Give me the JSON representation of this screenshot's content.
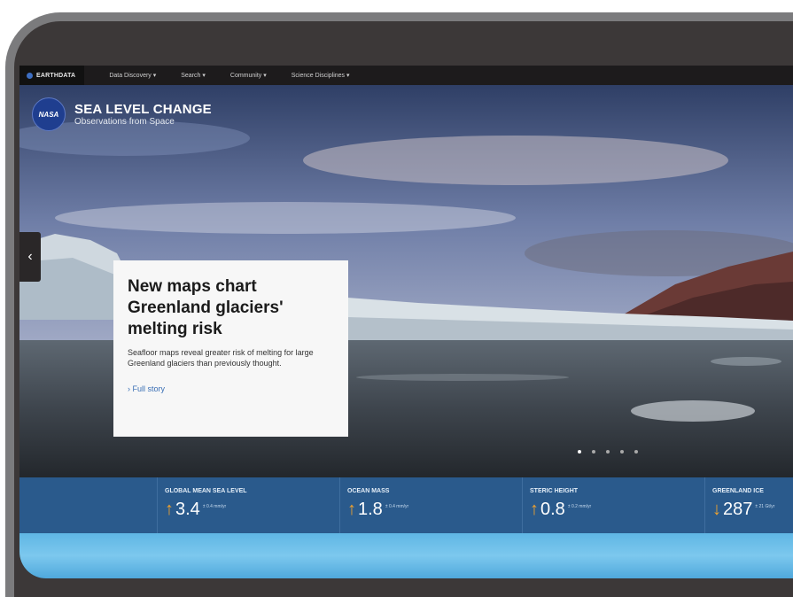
{
  "topnav": {
    "brand": "EARTHDATA",
    "items": [
      "Data Discovery ▾",
      "Search ▾",
      "Community ▾",
      "Science Disciplines ▾"
    ]
  },
  "site": {
    "logo_text": "NASA",
    "title": "SEA LEVEL CHANGE",
    "subtitle": "Observations from Space"
  },
  "carousel": {
    "prev_icon": "‹",
    "story_title": "New maps chart Greenland glaciers' melting risk",
    "story_text": "Seafloor maps reveal greater risk of melting for large Greenland glaciers than previously thought.",
    "story_link": "› Full story",
    "slide_count": 5,
    "active_slide": 1
  },
  "indicators": [
    {
      "label": "GLOBAL MEAN SEA LEVEL",
      "value": "3.4",
      "unit": "± 0.4 mm/yr",
      "direction": "up"
    },
    {
      "label": "OCEAN MASS",
      "value": "1.8",
      "unit": "± 0.4 mm/yr",
      "direction": "up"
    },
    {
      "label": "STERIC HEIGHT",
      "value": "0.8",
      "unit": "± 0.2 mm/yr",
      "direction": "up"
    },
    {
      "label": "GREENLAND ICE",
      "value": "287",
      "unit": "± 21 Gt/yr",
      "direction": "down"
    }
  ],
  "colors": {
    "indicator_bar": "#2a5a8c",
    "arrow": "#f0a22e",
    "link": "#3a6fb5"
  }
}
